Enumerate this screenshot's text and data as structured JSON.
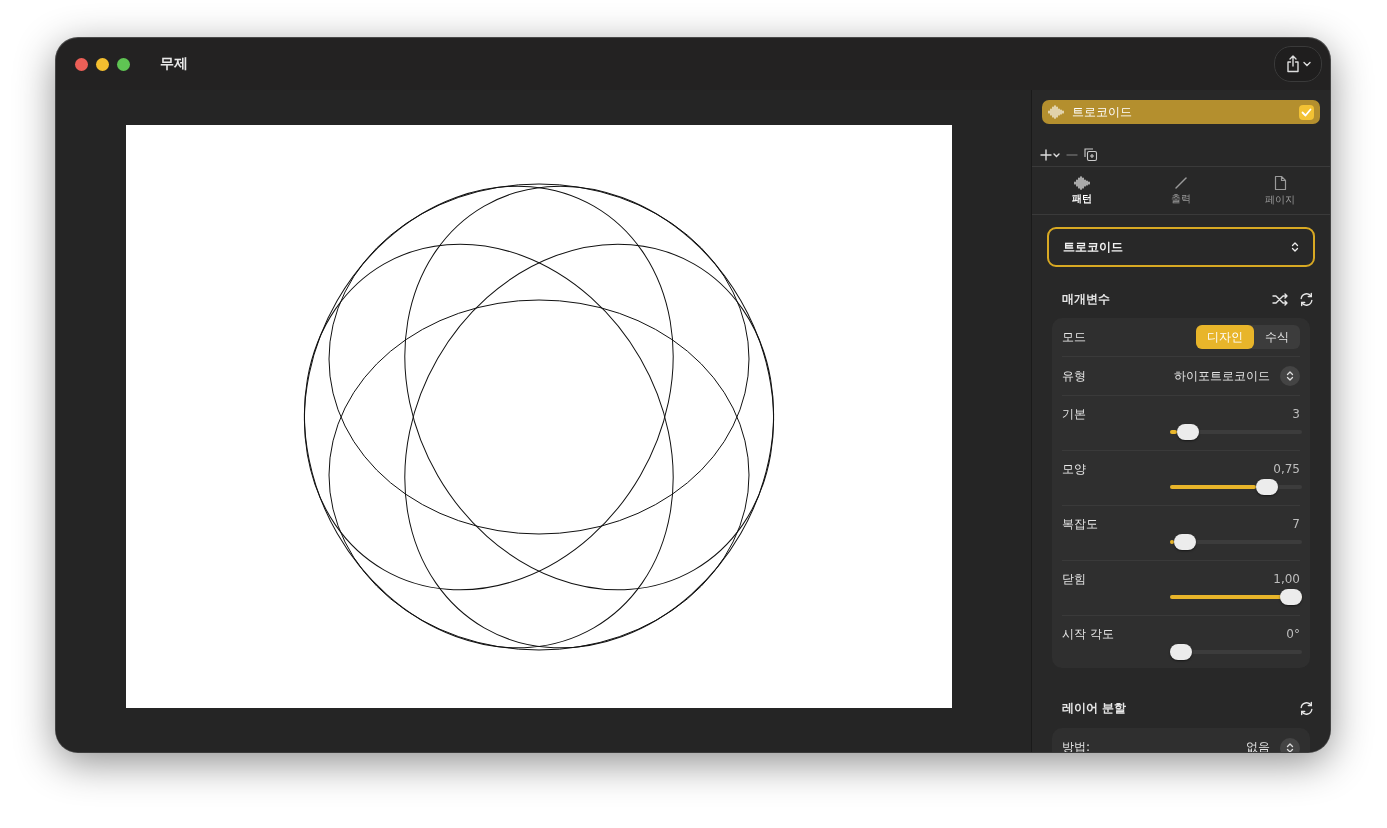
{
  "window": {
    "title": "무제"
  },
  "layers": [
    {
      "name": "트로코이드",
      "selected": true,
      "checked": true
    }
  ],
  "inspector_tabs": [
    {
      "label": "패턴",
      "kind": "wave",
      "selected": true
    },
    {
      "label": "출력",
      "kind": "pen",
      "selected": false
    },
    {
      "label": "페이지",
      "kind": "page",
      "selected": false
    }
  ],
  "pattern_dropdown": {
    "value": "트로코이드"
  },
  "parameters": {
    "title": "매개변수",
    "rows": [
      {
        "kind": "segmented",
        "label": "모드",
        "options": [
          {
            "label": "디자인",
            "selected": true
          },
          {
            "label": "수식",
            "selected": false
          }
        ]
      },
      {
        "kind": "popup",
        "label": "유형",
        "value": "하이포트로코이드"
      },
      {
        "kind": "slider",
        "label": "기본",
        "reading": "3",
        "level": 0.05
      },
      {
        "kind": "slider",
        "label": "모양",
        "reading": "0,75",
        "level": 0.65
      },
      {
        "kind": "slider",
        "label": "복잡도",
        "reading": "7",
        "level": 0.03
      },
      {
        "kind": "slider",
        "label": "닫힘",
        "reading": "1,00",
        "level": 1
      },
      {
        "kind": "slider",
        "label": "시작 각도",
        "reading": "0°",
        "level": 0
      }
    ]
  },
  "layer_split": {
    "title": "레이어 분할",
    "rows": [
      {
        "kind": "popup",
        "label": "방법:",
        "value": "없음"
      }
    ]
  }
}
